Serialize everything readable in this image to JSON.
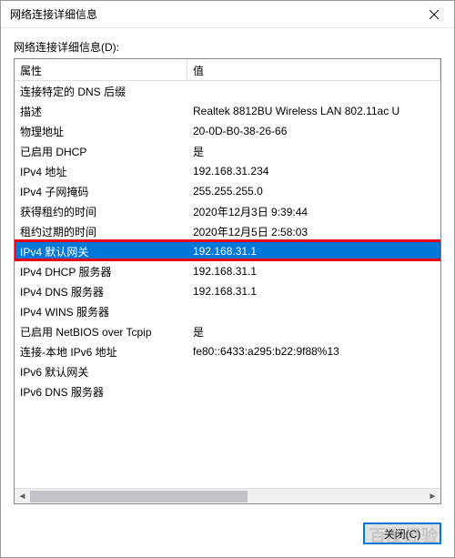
{
  "window": {
    "title": "网络连接详细信息",
    "list_label": "网络连接详细信息(D):"
  },
  "columns": {
    "property": "属性",
    "value": "值"
  },
  "rows": [
    {
      "prop": "连接特定的 DNS 后缀",
      "val": ""
    },
    {
      "prop": "描述",
      "val": "Realtek 8812BU Wireless LAN 802.11ac U"
    },
    {
      "prop": "物理地址",
      "val": "20-0D-B0-38-26-66"
    },
    {
      "prop": "已启用 DHCP",
      "val": "是"
    },
    {
      "prop": "IPv4 地址",
      "val": "192.168.31.234"
    },
    {
      "prop": "IPv4 子网掩码",
      "val": "255.255.255.0"
    },
    {
      "prop": "获得租约的时间",
      "val": "2020年12月3日 9:39:44"
    },
    {
      "prop": "租约过期的时间",
      "val": "2020年12月5日 2:58:03"
    },
    {
      "prop": "IPv4 默认网关",
      "val": "192.168.31.1",
      "selected": true,
      "highlight": true
    },
    {
      "prop": "IPv4 DHCP 服务器",
      "val": "192.168.31.1"
    },
    {
      "prop": "IPv4 DNS 服务器",
      "val": "192.168.31.1"
    },
    {
      "prop": "IPv4 WINS 服务器",
      "val": ""
    },
    {
      "prop": "已启用 NetBIOS over Tcpip",
      "val": "是"
    },
    {
      "prop": "连接-本地 IPv6 地址",
      "val": "fe80::6433:a295:b22:9f88%13"
    },
    {
      "prop": "IPv6 默认网关",
      "val": ""
    },
    {
      "prop": "IPv6 DNS 服务器",
      "val": ""
    }
  ],
  "buttons": {
    "close": "关闭(C)"
  },
  "watermark": "百度经验"
}
